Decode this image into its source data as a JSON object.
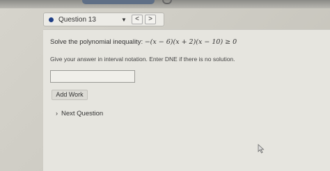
{
  "header": {
    "question_label": "Question 13",
    "prev_glyph": "<",
    "next_glyph": ">",
    "dropdown_glyph": "▼"
  },
  "question": {
    "prompt_text": "Solve the polynomial inequality: ",
    "inequality": "−(x − 6)(x + 2)(x − 10) ≥ 0",
    "instructions": "Give your answer in interval notation. Enter DNE if there is no solution."
  },
  "answer": {
    "value": "",
    "placeholder": ""
  },
  "actions": {
    "add_work_label": "Add Work",
    "next_question_label": "Next Question",
    "next_question_glyph": "›"
  },
  "colors": {
    "status_dot": "#1f3f86",
    "top_button": "#5f6f86"
  },
  "icons": [
    "status-dot-icon",
    "chevron-down-icon",
    "chevron-left-icon",
    "chevron-right-icon",
    "mouse-cursor-icon"
  ]
}
